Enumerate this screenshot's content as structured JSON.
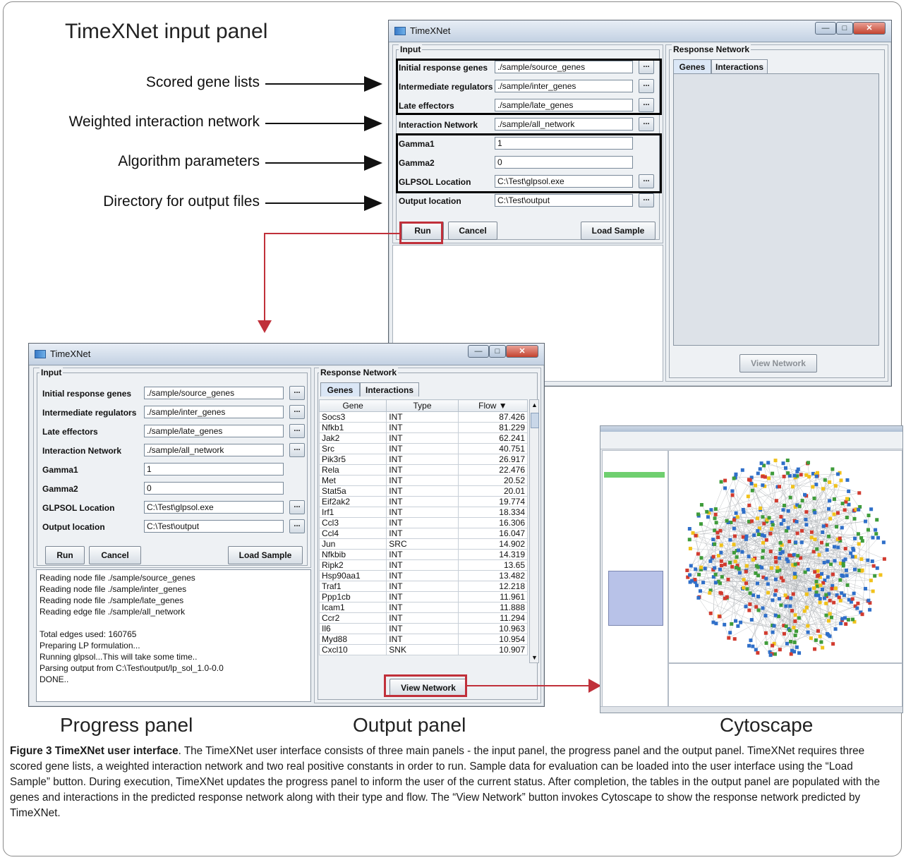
{
  "labels": {
    "input_panel_title": "TimeXNet input panel",
    "progress_panel": "Progress panel",
    "output_panel": "Output panel",
    "cytoscape": "Cytoscape"
  },
  "callouts": [
    "Scored gene lists",
    "Weighted interaction network",
    "Algorithm parameters",
    "Directory for output files"
  ],
  "window": {
    "title": "TimeXNet",
    "input_legend": "Input",
    "response_legend": "Response Network",
    "fields": [
      {
        "label": "Initial response genes",
        "value": "./sample/source_genes",
        "browse": true
      },
      {
        "label": "Intermediate regulators",
        "value": "./sample/inter_genes",
        "browse": true
      },
      {
        "label": "Late effectors",
        "value": "./sample/late_genes",
        "browse": true
      },
      {
        "label": "Interaction Network",
        "value": "./sample/all_network",
        "browse": true
      },
      {
        "label": "Gamma1",
        "value": "1",
        "browse": false
      },
      {
        "label": "Gamma2",
        "value": "0",
        "browse": false
      },
      {
        "label": "GLPSOL Location",
        "value": "C:\\Test\\glpsol.exe",
        "browse": true
      },
      {
        "label": "Output location",
        "value": "C:\\Test\\output",
        "browse": true
      }
    ],
    "browse_label": "...",
    "run": "Run",
    "cancel": "Cancel",
    "load_sample": "Load Sample",
    "tabs": [
      "Genes",
      "Interactions"
    ],
    "view_network": "View Network"
  },
  "progress_log": [
    "Reading node file ./sample/source_genes",
    "Reading node file ./sample/inter_genes",
    "Reading node file ./sample/late_genes",
    "Reading edge file ./sample/all_network",
    "",
    "Total edges used: 160765",
    "Preparing LP formulation...",
    "Running glpsol...This will take some time..",
    "Parsing output from C:\\Test\\output/lp_sol_1.0-0.0",
    "DONE.."
  ],
  "gene_table": {
    "columns": [
      "Gene",
      "Type",
      "Flow ▼"
    ],
    "rows": [
      [
        "Socs3",
        "INT",
        "87.426"
      ],
      [
        "Nfkb1",
        "INT",
        "81.229"
      ],
      [
        "Jak2",
        "INT",
        "62.241"
      ],
      [
        "Src",
        "INT",
        "40.751"
      ],
      [
        "Pik3r5",
        "INT",
        "26.917"
      ],
      [
        "Rela",
        "INT",
        "22.476"
      ],
      [
        "Met",
        "INT",
        "20.52"
      ],
      [
        "Stat5a",
        "INT",
        "20.01"
      ],
      [
        "Eif2ak2",
        "INT",
        "19.774"
      ],
      [
        "Irf1",
        "INT",
        "18.334"
      ],
      [
        "Ccl3",
        "INT",
        "16.306"
      ],
      [
        "Ccl4",
        "INT",
        "16.047"
      ],
      [
        "Jun",
        "SRC",
        "14.902"
      ],
      [
        "Nfkbib",
        "INT",
        "14.319"
      ],
      [
        "Ripk2",
        "INT",
        "13.65"
      ],
      [
        "Hsp90aa1",
        "INT",
        "13.482"
      ],
      [
        "Traf1",
        "INT",
        "12.218"
      ],
      [
        "Ppp1cb",
        "INT",
        "11.961"
      ],
      [
        "Icam1",
        "INT",
        "11.888"
      ],
      [
        "Ccr2",
        "INT",
        "11.294"
      ],
      [
        "Il6",
        "INT",
        "10.963"
      ],
      [
        "Myd88",
        "INT",
        "10.954"
      ],
      [
        "Cxcl10",
        "SNK",
        "10.907"
      ]
    ]
  },
  "caption": {
    "figure_label": "Figure 3 TimeXNet user interface",
    "text": ". The TimeXNet user interface consists of three main panels - the input panel, the progress panel and the output panel. TimeXNet requires three scored gene lists, a weighted interaction network and two real positive constants in order to run. Sample data for evaluation can be loaded into the user interface using the “Load Sample” button. During execution, TimeXNet updates the progress panel to inform the user of the current status. After completion, the tables in the output panel are populated with the genes and interactions in the predicted response network along with their type and flow. The “View Network” button invokes Cytoscape to show the response network predicted by TimeXNet."
  },
  "colors": {
    "highlight_red": "#c0303a",
    "node_blue": "#2f6fc9",
    "node_red": "#d23b2f",
    "node_yellow": "#f1c21b",
    "node_green": "#3f9c3a"
  }
}
